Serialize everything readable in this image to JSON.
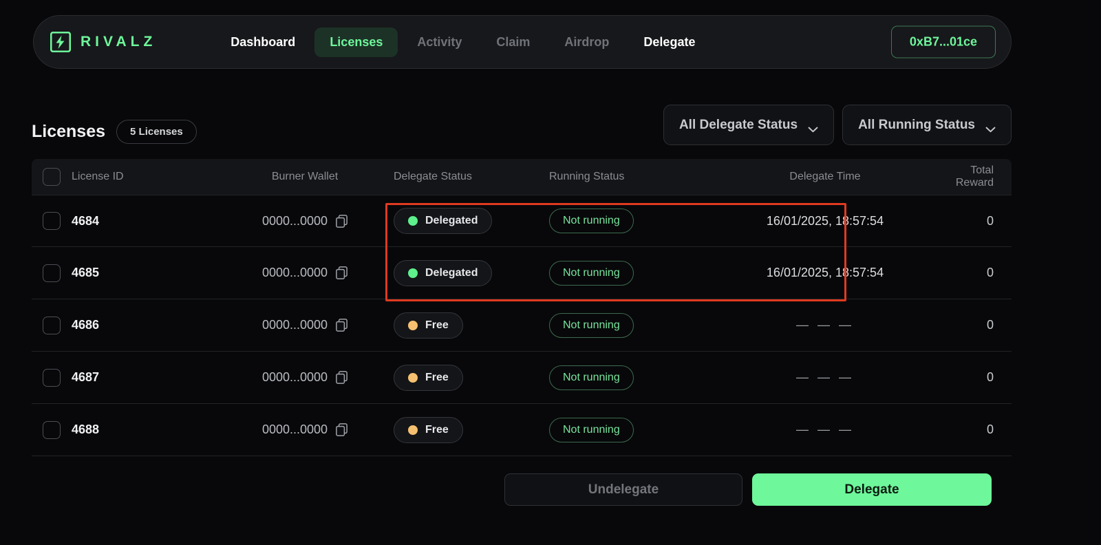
{
  "brand": {
    "name": "RIVALZ",
    "logo_icon": "lightning-bolt-icon"
  },
  "nav": {
    "items": [
      {
        "label": "Dashboard",
        "state": "strong"
      },
      {
        "label": "Licenses",
        "state": "active"
      },
      {
        "label": "Activity",
        "state": "muted"
      },
      {
        "label": "Claim",
        "state": "muted"
      },
      {
        "label": "Airdrop",
        "state": "muted"
      },
      {
        "label": "Delegate",
        "state": "strong"
      }
    ],
    "wallet": "0xB7...01ce"
  },
  "header": {
    "title": "Licenses",
    "count_badge": "5 Licenses",
    "filters": [
      {
        "label": "All Delegate Status",
        "icon": "chevron-down-icon"
      },
      {
        "label": "All Running Status",
        "icon": "chevron-down-icon"
      }
    ]
  },
  "table": {
    "columns": [
      "License ID",
      "Burner Wallet",
      "Delegate Status",
      "Running Status",
      "Delegate Time",
      "Total Reward"
    ],
    "rows": [
      {
        "id": "4684",
        "wallet": "0000...0000",
        "delegate_status": "Delegated",
        "delegate_dot": "#5ef08c",
        "running_status": "Not running",
        "delegate_time": "16/01/2025, 18:57:54",
        "reward": "0"
      },
      {
        "id": "4685",
        "wallet": "0000...0000",
        "delegate_status": "Delegated",
        "delegate_dot": "#5ef08c",
        "running_status": "Not running",
        "delegate_time": "16/01/2025, 18:57:54",
        "reward": "0"
      },
      {
        "id": "4686",
        "wallet": "0000...0000",
        "delegate_status": "Free",
        "delegate_dot": "#f5c070",
        "running_status": "Not running",
        "delegate_time": "— — —",
        "reward": "0"
      },
      {
        "id": "4687",
        "wallet": "0000...0000",
        "delegate_status": "Free",
        "delegate_dot": "#f5c070",
        "running_status": "Not running",
        "delegate_time": "— — —",
        "reward": "0"
      },
      {
        "id": "4688",
        "wallet": "0000...0000",
        "delegate_status": "Free",
        "delegate_dot": "#f5c070",
        "running_status": "Not running",
        "delegate_time": "— — —",
        "reward": "0"
      }
    ]
  },
  "actions": {
    "undelegate": "Undelegate",
    "delegate": "Delegate"
  },
  "colors": {
    "accent_green": "#6ef79b",
    "annotation_red": "#e03a20",
    "free_amber": "#f5c070"
  }
}
